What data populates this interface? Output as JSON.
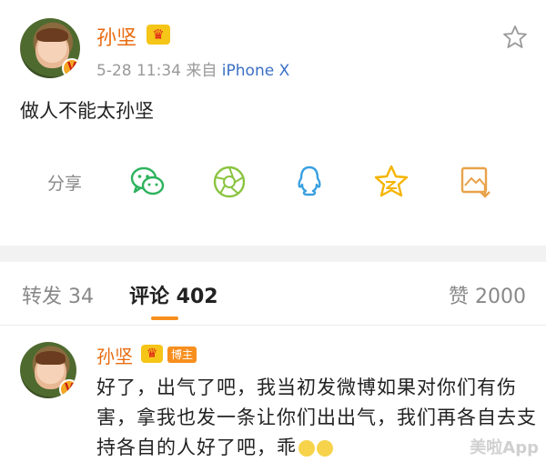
{
  "post": {
    "username": "孙坚",
    "crown_icon": "crown-icon",
    "timestamp": "5-28 11:34",
    "source_prefix": "来自",
    "source": "iPhone X",
    "text": "做人不能太孙坚",
    "verified_icon": "verified-v-icon",
    "share": {
      "label": "分享",
      "icons": [
        "wechat-icon",
        "moments-icon",
        "qq-icon",
        "qzone-icon",
        "save-image-icon"
      ]
    }
  },
  "tabs": {
    "repost": "转发 34",
    "comments": "评论 402",
    "likes": "赞 2000"
  },
  "comment": {
    "username": "孙坚",
    "author_tag": "博主",
    "text": "好了，出气了吧，我当初发微博如果对你们有伤害，拿我也发一条让你们出出气，我们再各自去支持各自的人好了吧，乖",
    "emojis": [
      "hug-emoji",
      "hug-emoji"
    ]
  },
  "watermark": "美啦App",
  "colors": {
    "username": "#e86b0f",
    "source_link": "#3a6fc4",
    "accent": "#f78f1e",
    "wechat": "#2db35d",
    "moments": "#8ac43f",
    "qq": "#39a0e0",
    "qzone": "#f5b400",
    "save": "#e8a24a"
  }
}
